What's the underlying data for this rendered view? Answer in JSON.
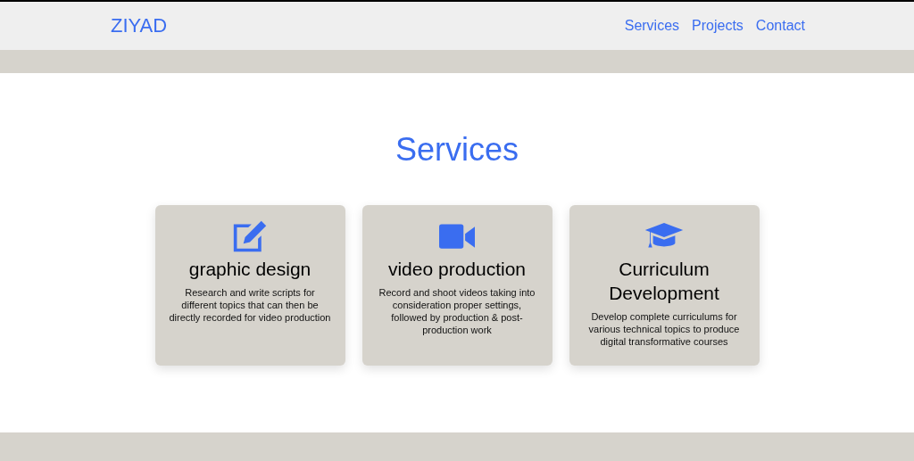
{
  "header": {
    "logo": "ZIYAD",
    "nav": [
      {
        "label": "Services"
      },
      {
        "label": "Projects"
      },
      {
        "label": "Contact"
      }
    ]
  },
  "services": {
    "title": "Services",
    "cards": [
      {
        "kind": "pencil",
        "title": "graphic design",
        "text": "Research and write scripts for different topics that can then be directly recorded for video production"
      },
      {
        "kind": "video",
        "title": "video production",
        "text": "Record and shoot videos taking into consideration proper settings, followed by production & post-production work"
      },
      {
        "kind": "cap",
        "title": "Curriculum Development",
        "text": "Develop complete curriculums for various technical topics to produce digital transformative courses"
      }
    ]
  }
}
